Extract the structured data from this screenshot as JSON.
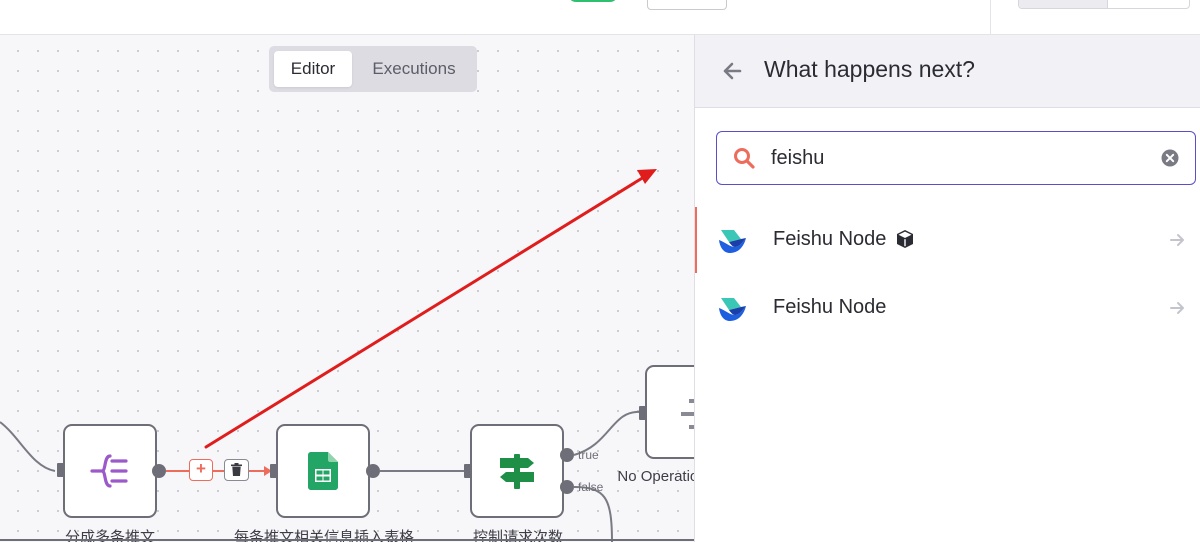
{
  "view_toggle": {
    "editor": "Editor",
    "executions": "Executions",
    "active": "editor"
  },
  "nodes": [
    {
      "label": "分成多条推文",
      "icon": "split-out-icon"
    },
    {
      "label": "每条推文相关信息插入表格",
      "icon": "google-sheets-icon"
    },
    {
      "label": "控制请求次数",
      "icon": "signpost-icon"
    },
    {
      "label": "No Operation",
      "icon": "no-op-icon"
    }
  ],
  "branches": {
    "true_label": "true",
    "false_label": "false"
  },
  "panel": {
    "title": "What happens next?",
    "search": {
      "value": "feishu"
    },
    "results": [
      {
        "label": "Feishu Node",
        "badge": "cube-icon",
        "selected": true
      },
      {
        "label": "Feishu Node",
        "badge": "",
        "selected": false
      }
    ]
  },
  "colors": {
    "accent": "#ee6c5b",
    "focus": "#5b4fc9",
    "annotation": "#e01d1d",
    "split_icon": "#9b59c9",
    "sheets_icon": "#23a566",
    "signpost_icon": "#1f8f47"
  }
}
